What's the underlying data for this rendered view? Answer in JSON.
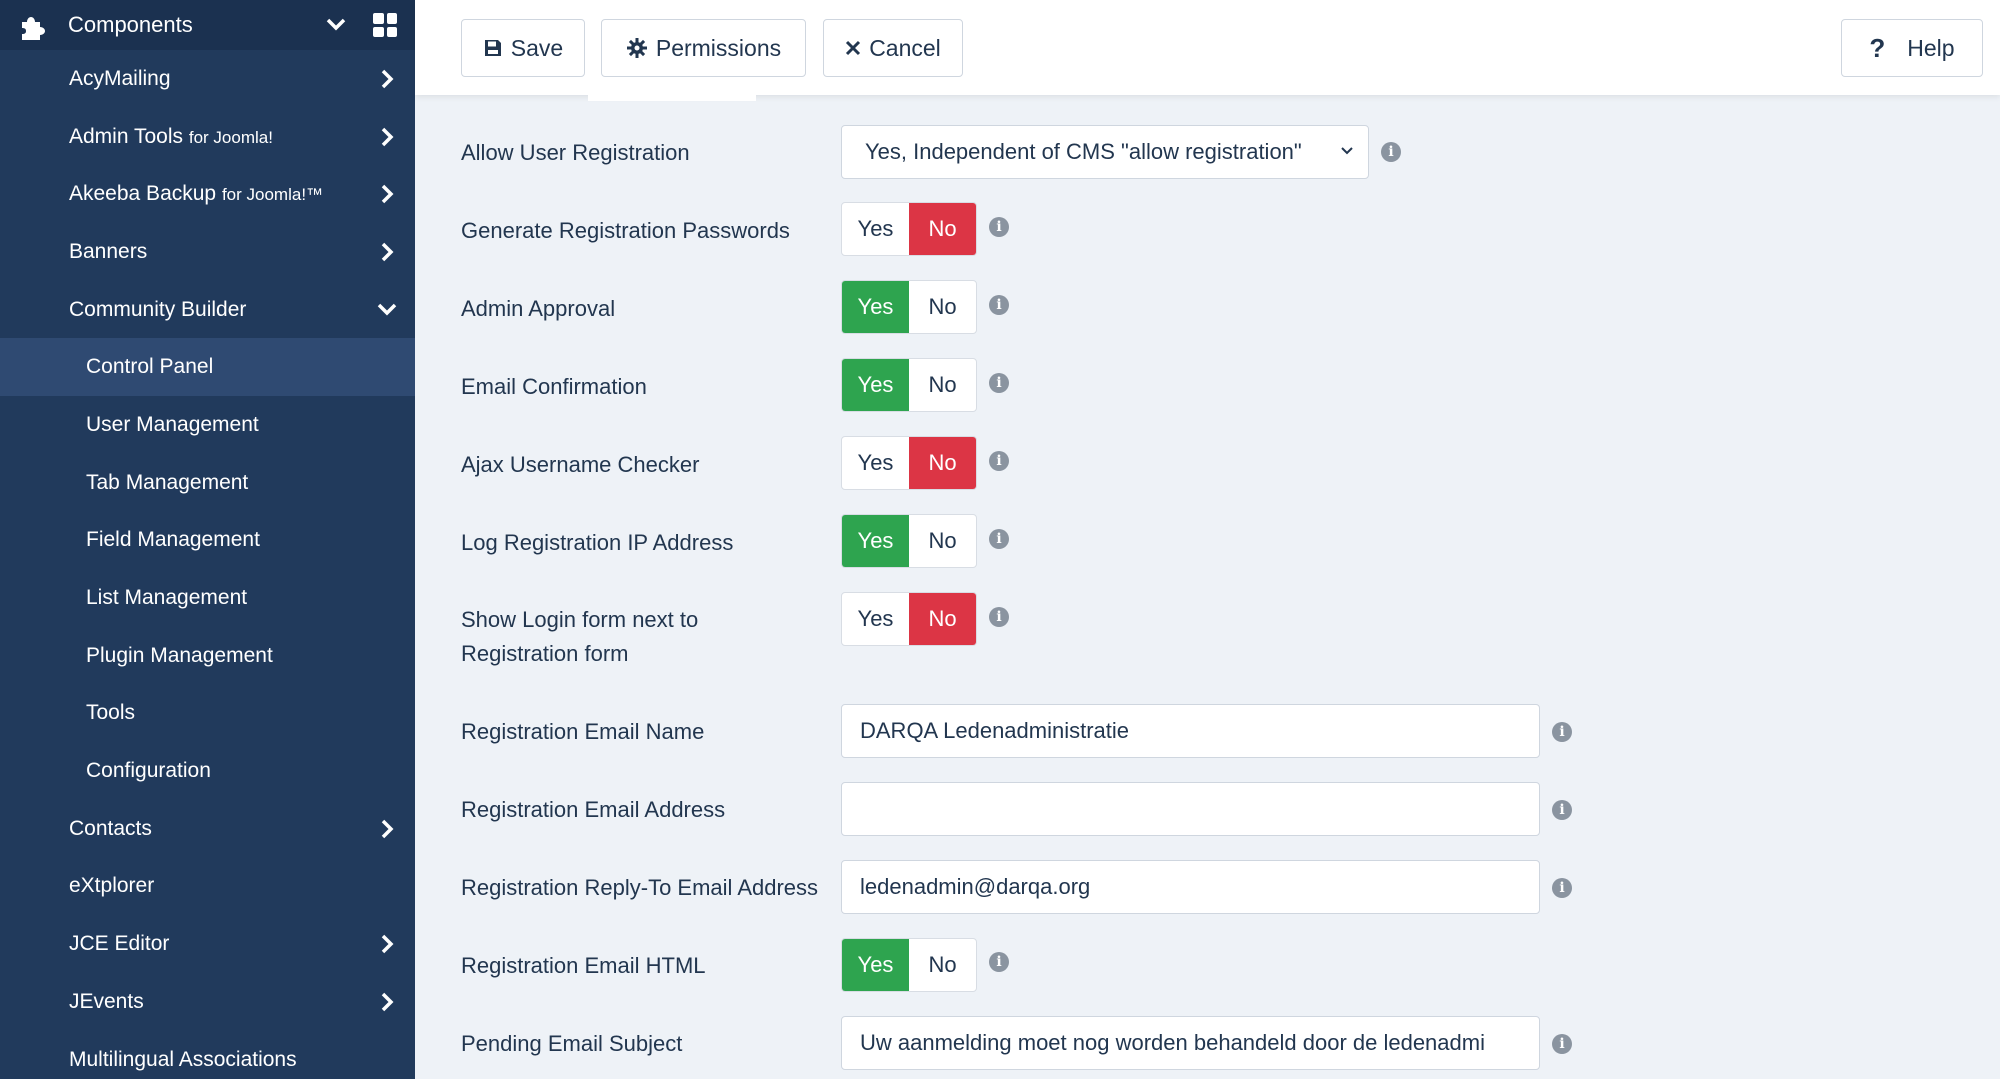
{
  "sidebar": {
    "header_title": "Components",
    "items": [
      {
        "label": "AcyMailing",
        "suffix": "",
        "arrow": "right"
      },
      {
        "label": "Admin Tools",
        "suffix": "for Joomla!",
        "arrow": "right"
      },
      {
        "label": "Akeeba Backup",
        "suffix": "for Joomla!™",
        "arrow": "right"
      },
      {
        "label": "Banners",
        "suffix": "",
        "arrow": "right"
      },
      {
        "label": "Community Builder",
        "suffix": "",
        "arrow": "down"
      }
    ],
    "sub_items": [
      {
        "label": "Control Panel",
        "active": true
      },
      {
        "label": "User Management"
      },
      {
        "label": "Tab Management"
      },
      {
        "label": "Field Management"
      },
      {
        "label": "List Management"
      },
      {
        "label": "Plugin Management"
      },
      {
        "label": "Tools"
      },
      {
        "label": "Configuration"
      }
    ],
    "items_after": [
      {
        "label": "Contacts",
        "arrow": "right"
      },
      {
        "label": "eXtplorer",
        "arrow": ""
      },
      {
        "label": "JCE Editor",
        "arrow": "right"
      },
      {
        "label": "JEvents",
        "arrow": "right"
      },
      {
        "label": "Multilingual Associations",
        "arrow": ""
      }
    ]
  },
  "toolbar": {
    "save_label": "Save",
    "permissions_label": "Permissions",
    "cancel_label": "Cancel",
    "help_label": "Help"
  },
  "toggle_labels": {
    "yes": "Yes",
    "no": "No"
  },
  "form": {
    "allow_registration": {
      "label": "Allow User Registration",
      "value": "Yes, Independent of CMS \"allow registration\""
    },
    "generate_passwords": {
      "label": "Generate Registration Passwords",
      "value": "No"
    },
    "admin_approval": {
      "label": "Admin Approval",
      "value": "Yes"
    },
    "email_confirmation": {
      "label": "Email Confirmation",
      "value": "Yes"
    },
    "ajax_username": {
      "label": "Ajax Username Checker",
      "value": "No"
    },
    "log_ip": {
      "label": "Log Registration IP Address",
      "value": "Yes"
    },
    "show_login": {
      "label_line1": "Show Login form next to",
      "label_line2": "Registration form",
      "value": "No"
    },
    "email_name": {
      "label": "Registration Email Name",
      "value": "DARQA Ledenadministratie"
    },
    "email_address": {
      "label": "Registration Email Address",
      "value": ""
    },
    "reply_to": {
      "label": "Registration Reply-To Email Address",
      "value": "ledenadmin@darqa.org"
    },
    "email_html": {
      "label": "Registration Email HTML",
      "value": "Yes"
    },
    "pending_subject": {
      "label": "Pending Email Subject",
      "value": "Uw aanmelding moet nog worden behandeld door de ledenadmi"
    }
  },
  "colors": {
    "sidebar": "#213a5c",
    "yes_active": "#2ea44f",
    "no_active": "#dc3545"
  }
}
